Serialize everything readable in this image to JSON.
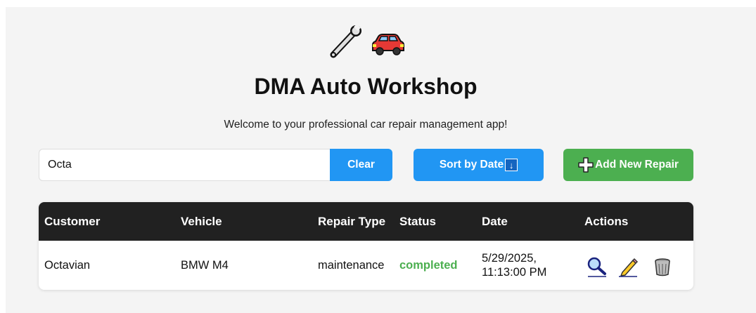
{
  "header": {
    "logo_icons": [
      "wrench-icon",
      "car-icon"
    ],
    "title": "DMA Auto Workshop",
    "subtitle": "Welcome to your professional car repair management app!"
  },
  "toolbar": {
    "search_value": "Octa",
    "clear_label": "Clear",
    "sort_label": "Sort by Date",
    "sort_arrow": "↓",
    "add_label": "Add New Repair"
  },
  "table": {
    "columns": [
      "Customer",
      "Vehicle",
      "Repair Type",
      "Status",
      "Date",
      "Actions"
    ],
    "rows": [
      {
        "customer": "Octavian",
        "vehicle": "BMW M4",
        "repair_type": "maintenance",
        "status": "completed",
        "date_line1": "5/29/2025,",
        "date_line2": "11:13:00 PM",
        "actions": [
          "magnifier-icon",
          "pencil-icon",
          "trash-icon"
        ]
      }
    ]
  },
  "colors": {
    "primary_blue": "#2196f3",
    "add_green": "#4caf50",
    "header_dark": "#212121",
    "status_completed": "#4caf50"
  }
}
